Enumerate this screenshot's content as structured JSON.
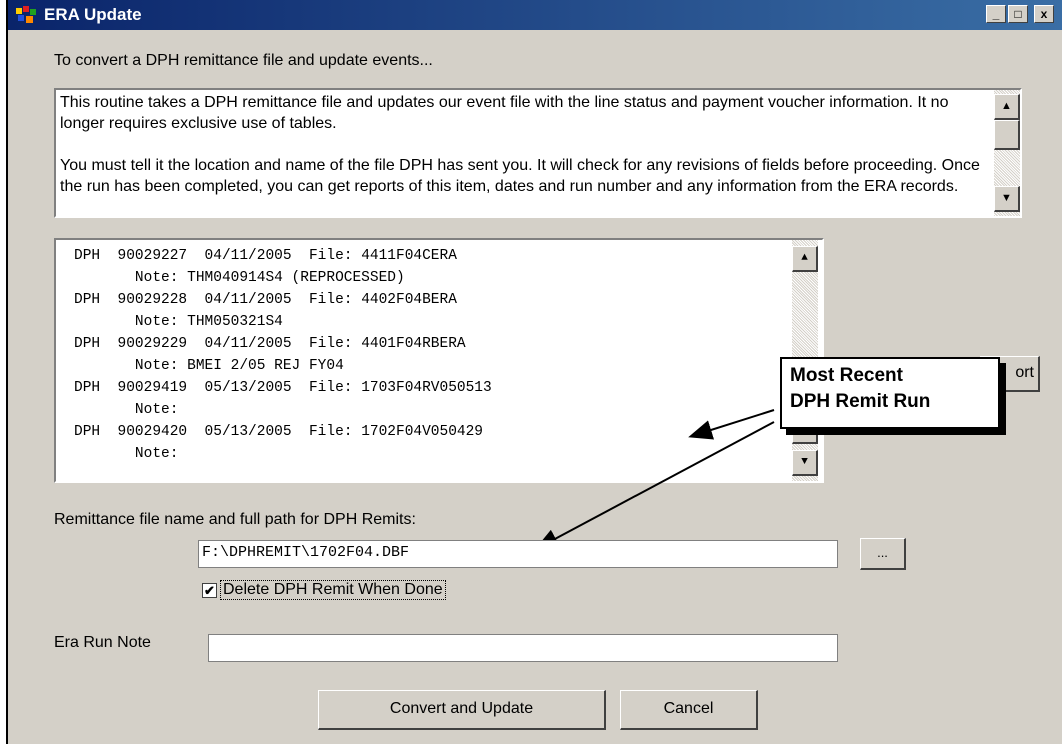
{
  "window": {
    "title": "ERA Update",
    "controls": {
      "minimize": "_",
      "maximize": "□",
      "close": "x"
    }
  },
  "header_text": "To convert a DPH remittance file and update events...",
  "description": {
    "paragraph1": "This routine takes a DPH remittance file and updates our event file with the line status and payment voucher information.  It no longer requires exclusive use of tables.",
    "paragraph2": "You must tell it the location and name of the file DPH has sent you.  It will check for any revisions of fields before proceeding.  Once the run has been completed, you can get reports of this item, dates and run number and any information from the ERA records."
  },
  "run_list": [
    {
      "source": "DPH",
      "number": "90029227",
      "date": "04/11/2005",
      "file_label": "File:",
      "file": "4411F04CERA",
      "note_label": "Note:",
      "note": "THM040914S4 (REPROCESSED)"
    },
    {
      "source": "DPH",
      "number": "90029228",
      "date": "04/11/2005",
      "file_label": "File:",
      "file": "4402F04BERA",
      "note_label": "Note:",
      "note": "THM050321S4"
    },
    {
      "source": "DPH",
      "number": "90029229",
      "date": "04/11/2005",
      "file_label": "File:",
      "file": "4401F04RBERA",
      "note_label": "Note:",
      "note": "BMEI 2/05 REJ FY04"
    },
    {
      "source": "DPH",
      "number": "90029419",
      "date": "05/13/2005",
      "file_label": "File:",
      "file": "1703F04RV050513",
      "note_label": "Note:",
      "note": ""
    },
    {
      "source": "DPH",
      "number": "90029420",
      "date": "05/13/2005",
      "file_label": "File:",
      "file": "1702F04V050429",
      "note_label": "Note:",
      "note": ""
    }
  ],
  "report_button_partial": "ort",
  "callout": {
    "line1": "Most Recent",
    "line2": "DPH Remit Run"
  },
  "remit_path": {
    "label": "Remittance file name and full path for DPH Remits:",
    "value": "F:\\DPHREMIT\\1702F04.DBF",
    "browse_label": "..."
  },
  "delete_checkbox": {
    "label": "Delete DPH Remit When Done",
    "checked": true,
    "mark": "✔"
  },
  "era_note": {
    "label": "Era Run Note",
    "value": ""
  },
  "buttons": {
    "convert": "Convert and Update",
    "cancel": "Cancel"
  },
  "scroll_glyphs": {
    "up": "▲",
    "down": "▼"
  }
}
